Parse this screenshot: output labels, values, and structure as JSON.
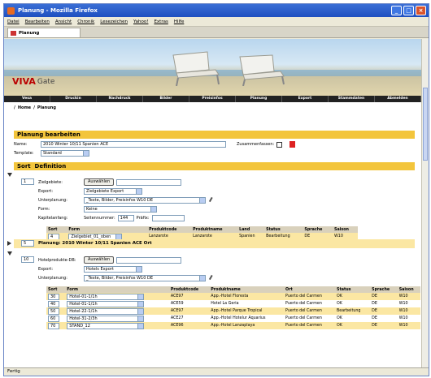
{
  "window": {
    "title": "Planung - Mozilla Firefox"
  },
  "menu": [
    "Datei",
    "Bearbeiten",
    "Ansicht",
    "Chronik",
    "Lesezeichen",
    "Yahoo!",
    "Extras",
    "Hilfe"
  ],
  "tab": {
    "label": "Planung"
  },
  "status": {
    "text": "Fertig"
  },
  "logo": {
    "brand": "VIVA",
    "suffix": "Gate"
  },
  "nav": [
    "Vesa",
    "Druckin",
    "Nachdruck",
    "Bilder",
    "Preisinfos",
    "Planung",
    "Export",
    "Stammdaten",
    "Abmelden"
  ],
  "breadcrumb": {
    "home": "Home",
    "sep": "/",
    "current": "Planung"
  },
  "form": {
    "heading": "Planung bearbeiten",
    "name_label": "Name:",
    "name_value": "2010 Winter 10/11 Spanien ACE",
    "merge_label": "Zusammenfassen:",
    "template_label": "Template:",
    "template_value": "Standard"
  },
  "section": {
    "sort_label": "Sort",
    "def_label": "Definition"
  },
  "block1": {
    "sort": "1",
    "target_label": "Zielgebiete:",
    "button": "Auswählen",
    "export_label": "Export:",
    "export_value": "Zielgebiete Export",
    "sub_label": "Unterplanung:",
    "sub_value": "_Texte, Bilder, Preisinfos W10 DE",
    "form_label": "Form:",
    "form_value": "Keine",
    "chapter_label": "Kapitelanfang:",
    "page_label": "Seitennummer:",
    "page_value": "144",
    "prefix_label": "Präfix:",
    "table": {
      "headers": [
        "Sort",
        "Form",
        "Produktcode",
        "Produktname",
        "Land",
        "Status",
        "Sprache",
        "Saison"
      ],
      "rows": [
        [
          "4",
          "Zielgebiet_01_oben",
          "Lanzarote",
          "Lanzarote",
          "Spanien",
          "Bearbeitung",
          "DE",
          "W10"
        ]
      ]
    }
  },
  "block2": {
    "sort": "5",
    "text": "Planung: 2010 Winter 10/11 Spanien ACE Ort"
  },
  "block3": {
    "sort": "10",
    "target_label": "Hotelprodukte-DB:",
    "button": "Auswählen",
    "export_label": "Export:",
    "export_value": "Hotels Export",
    "sub_label": "Unterplanung:",
    "sub_value": "_Texte, Bilder, Preisinfos W10 DE",
    "table": {
      "headers": [
        "Sort",
        "Form",
        "Produktcode",
        "Produktname",
        "Ort",
        "Status",
        "Sprache",
        "Saison"
      ],
      "rows": [
        [
          "30",
          "Hotel-01-1/1h",
          "ACE97",
          "App.-Hotel Floresta",
          "Puerto del Carmen",
          "OK",
          "DE",
          "W10"
        ],
        [
          "40",
          "Hotel-01-1/1h",
          "ACE59",
          "Hotel La Geria",
          "Puerto del Carmen",
          "OK",
          "DE",
          "W10"
        ],
        [
          "50",
          "Hotel-22-1/1h",
          "ACE97",
          "App.-Hotel Parque Tropical",
          "Puerto del Carmen",
          "Bearbeitung",
          "DE",
          "W10"
        ],
        [
          "60",
          "Hotel-31-2/3h",
          "ACE27",
          "App.-Hotel Hotelur Aquarius",
          "Puerto del Carmen",
          "OK",
          "DE",
          "W10"
        ],
        [
          "70",
          "STAND_12",
          "ACE96",
          "App.-Hotel Lanzaplaya",
          "Puerto del Carmen",
          "OK",
          "DE",
          "W10"
        ]
      ]
    }
  }
}
